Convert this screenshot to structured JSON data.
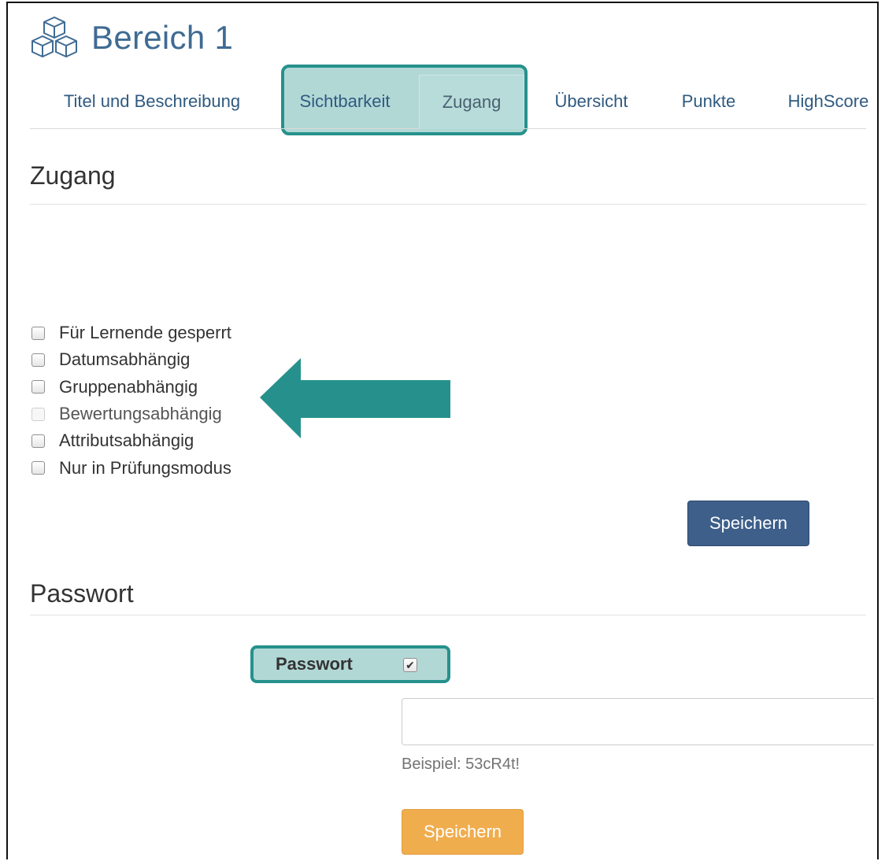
{
  "header": {
    "title": "Bereich 1",
    "icon": "cubes-icon"
  },
  "tabs": [
    {
      "label": "Titel und Beschreibung",
      "active": false
    },
    {
      "label": "Sichtbarkeit",
      "active": false
    },
    {
      "label": "Zugang",
      "active": true
    },
    {
      "label": "Übersicht",
      "active": false
    },
    {
      "label": "Punkte",
      "active": false
    },
    {
      "label": "HighScore",
      "active": false
    }
  ],
  "access": {
    "heading": "Zugang",
    "options": [
      {
        "label": "Für Lernende gesperrt",
        "checked": false,
        "disabled": false
      },
      {
        "label": "Datumsabhängig",
        "checked": false,
        "disabled": false
      },
      {
        "label": "Gruppenabhängig",
        "checked": false,
        "disabled": false
      },
      {
        "label": "Bewertungsabhängig",
        "checked": false,
        "disabled": true
      },
      {
        "label": "Attributsabhängig",
        "checked": false,
        "disabled": false
      },
      {
        "label": "Nur in Prüfungsmodus",
        "checked": false,
        "disabled": false
      }
    ],
    "save_label": "Speichern"
  },
  "password": {
    "heading": "Passwort",
    "label": "Passwort",
    "checked": true,
    "value": "",
    "help": "Beispiel: 53cR4t!",
    "save_label": "Speichern"
  },
  "colors": {
    "highlight": "#26918c",
    "primary": "#3d5f8a",
    "warning": "#f0ad4e",
    "title": "#3f6b93"
  }
}
